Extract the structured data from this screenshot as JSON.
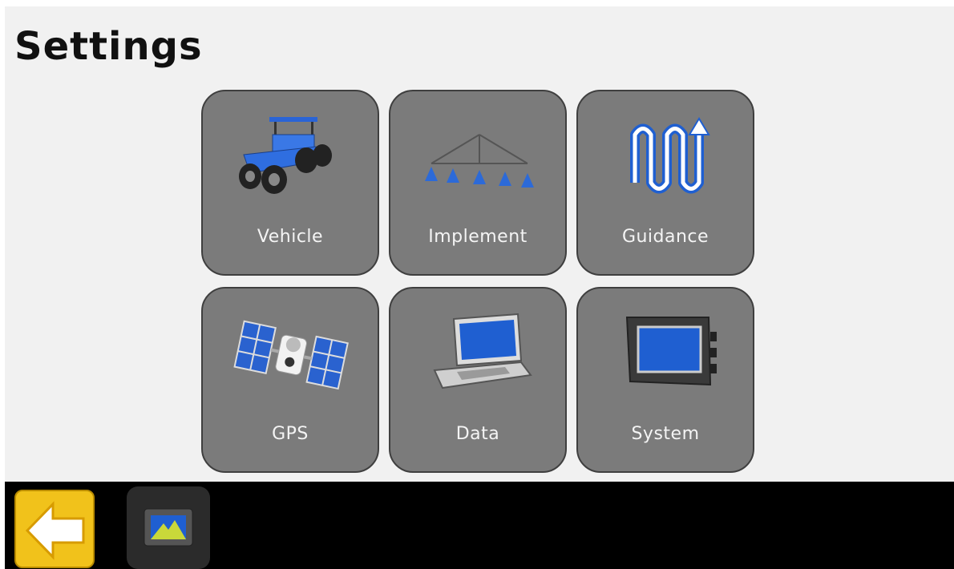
{
  "header": {
    "title": "Settings"
  },
  "tiles": [
    {
      "label": "Vehicle",
      "icon": "tractor-icon"
    },
    {
      "label": "Implement",
      "icon": "sprayer-boom-icon"
    },
    {
      "label": "Guidance",
      "icon": "guidance-path-icon"
    },
    {
      "label": "GPS",
      "icon": "satellite-icon"
    },
    {
      "label": "Data",
      "icon": "laptop-icon"
    },
    {
      "label": "System",
      "icon": "display-console-icon"
    }
  ],
  "bottom_bar": {
    "back_icon": "back-arrow-icon",
    "home_icon": "display-home-icon"
  },
  "colors": {
    "tile_bg": "#7b7b7b",
    "accent_blue": "#1f5fd1",
    "back_button": "#f1c21b",
    "bar_bg": "#000000",
    "screen_bg": "#f1f1f1"
  }
}
